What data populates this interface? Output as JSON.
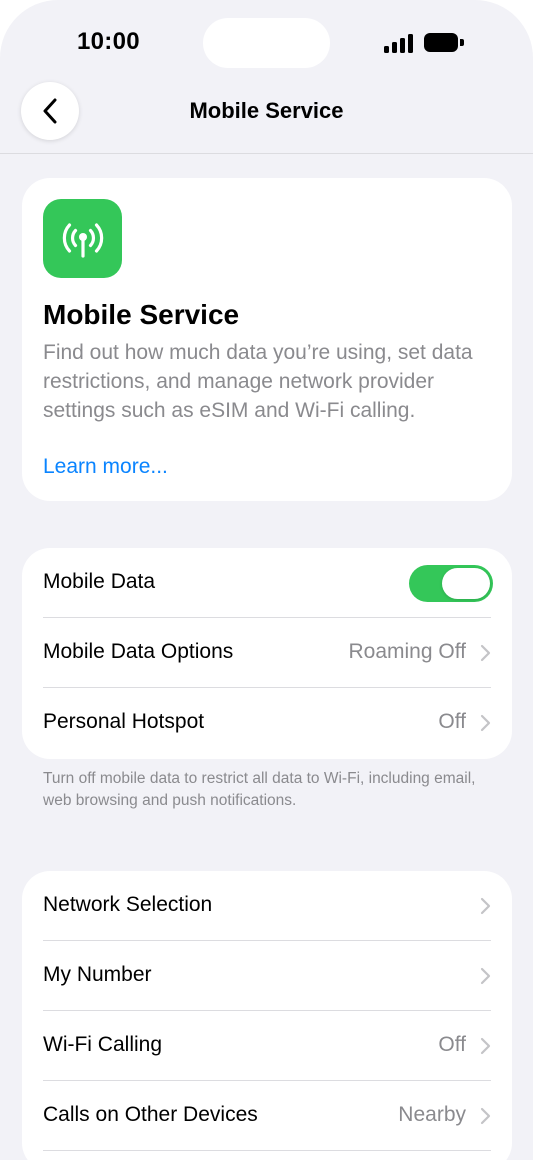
{
  "status_bar": {
    "time": "10:00"
  },
  "nav": {
    "title": "Mobile Service"
  },
  "intro": {
    "title": "Mobile Service",
    "description": "Find out how much data you’re using, set data restrictions, and manage network provider settings such as eSIM and Wi-Fi calling.",
    "learn_more": "Learn more..."
  },
  "data_section": {
    "rows": [
      {
        "label": "Mobile Data",
        "toggle_on": true
      },
      {
        "label": "Mobile Data Options",
        "value": "Roaming Off"
      },
      {
        "label": "Personal Hotspot",
        "value": "Off"
      }
    ],
    "footer": "Turn off mobile data to restrict all data to Wi-Fi, including email, web browsing and push notifications."
  },
  "network_section": {
    "rows": [
      {
        "label": "Network Selection",
        "value": ""
      },
      {
        "label": "My Number",
        "value": ""
      },
      {
        "label": "Wi-Fi Calling",
        "value": "Off"
      },
      {
        "label": "Calls on Other Devices",
        "value": "Nearby"
      }
    ]
  },
  "icons": [
    "chevron-left-icon",
    "antenna-icon",
    "chevron-right-icon",
    "signal-icon",
    "battery-icon"
  ],
  "colors": {
    "accent": "#34c759",
    "link": "#0a84ff",
    "background": "#f2f2f7",
    "secondary_text": "#8a8a8e"
  }
}
